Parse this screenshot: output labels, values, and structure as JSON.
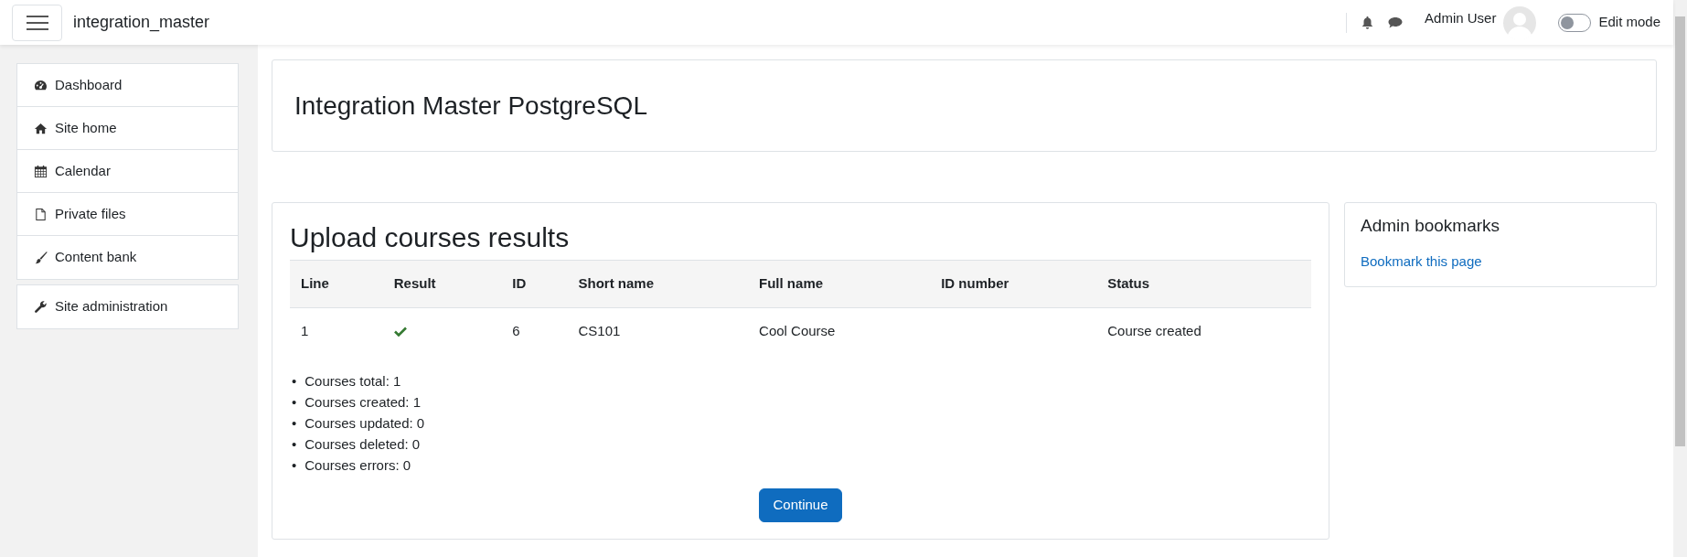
{
  "navbar": {
    "site_name": "integration_master",
    "user_name": "Admin User",
    "edit_mode": {
      "label": "Edit mode",
      "on": false
    }
  },
  "sidebar": {
    "groups": [
      {
        "items": [
          {
            "label": "Dashboard"
          },
          {
            "label": "Site home"
          },
          {
            "label": "Calendar"
          },
          {
            "label": "Private files"
          },
          {
            "label": "Content bank"
          }
        ]
      },
      {
        "items": [
          {
            "label": "Site administration"
          }
        ]
      }
    ]
  },
  "page_header": {
    "title": "Integration Master PostgreSQL"
  },
  "results": {
    "title": "Upload courses results",
    "table": {
      "columns": [
        "Line",
        "Result",
        "ID",
        "Short name",
        "Full name",
        "ID number",
        "Status"
      ],
      "rows": [
        {
          "line": "1",
          "succeeded": true,
          "id": "6",
          "short_name": "CS101",
          "full_name": "Cool Course",
          "status": "Course created"
        }
      ]
    },
    "summary": [
      {
        "marker": "•",
        "text": "Courses total: 1"
      },
      {
        "marker": "•",
        "text": "Courses created: 1"
      },
      {
        "marker": "•",
        "text": "Courses updated: 0"
      },
      {
        "marker": "•",
        "text": "Courses deleted: 0"
      },
      {
        "marker": "•",
        "text": "Courses errors: 0"
      }
    ],
    "button": "Continue"
  },
  "block": {
    "title": "Admin bookmarks",
    "link": "Bookmark this page"
  }
}
